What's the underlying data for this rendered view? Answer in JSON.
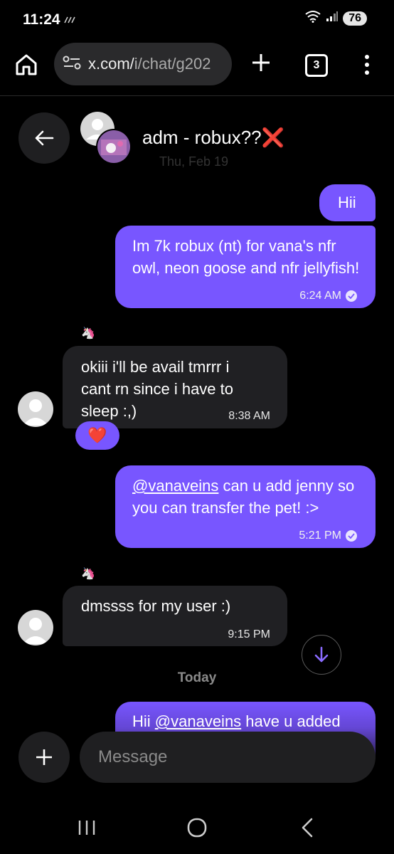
{
  "status_bar": {
    "time": "11:24",
    "battery": "76"
  },
  "browser": {
    "url_prefix": "x.com/",
    "url_rest": "i/chat/g202",
    "tab_count": "3"
  },
  "chat": {
    "title": "adm - robux??",
    "title_emoji": "❌",
    "date_label": "Thu, Feb 19"
  },
  "messages": [
    {
      "text": "Hii"
    },
    {
      "text": "Im 7k robux (nt) for vana's nfr owl, neon goose and nfr jellyfish!",
      "time": "6:24 AM"
    },
    {
      "sender_emoji": "🦄",
      "text": "okiii i'll be avail tmrrr i cant rn since i have to sleep :,)",
      "time": "8:38 AM",
      "reaction": "❤️"
    },
    {
      "mention": "@vanaveins",
      "text": " can u add jenny so you can transfer the pet! :>",
      "time": "5:21 PM"
    },
    {
      "sender_emoji": "🦄",
      "text": "dmssss for my user :)",
      "time": "9:15 PM"
    },
    {
      "prefix": "Hii ",
      "mention": "@vanaveins",
      "text": " have u added"
    }
  ],
  "divider_today": "Today",
  "composer": {
    "placeholder": "Message"
  },
  "colors": {
    "accent": "#7856ff",
    "bubble_received": "#202023",
    "background": "#000000"
  }
}
